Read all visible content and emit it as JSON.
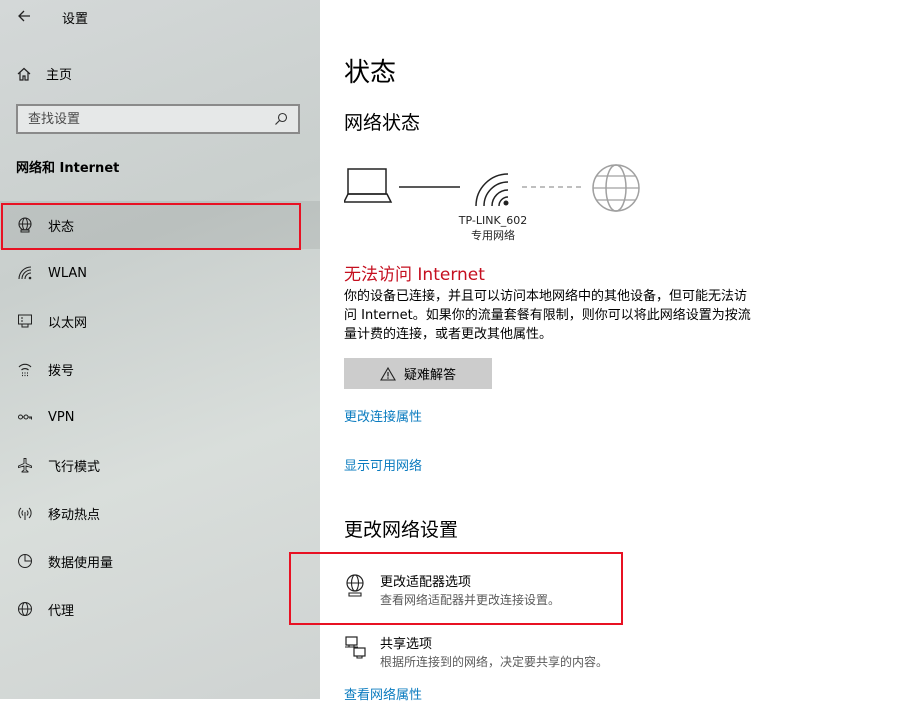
{
  "app": {
    "title": "设置"
  },
  "sidebar": {
    "home_label": "主页",
    "search_placeholder": "查找设置",
    "group_title": "网络和 Internet",
    "items": [
      {
        "label": "状态",
        "icon": "globe-status-icon",
        "selected": true
      },
      {
        "label": "WLAN",
        "icon": "wifi-icon"
      },
      {
        "label": "以太网",
        "icon": "ethernet-icon"
      },
      {
        "label": "拨号",
        "icon": "dialup-icon"
      },
      {
        "label": "VPN",
        "icon": "vpn-icon"
      },
      {
        "label": "飞行模式",
        "icon": "airplane-icon"
      },
      {
        "label": "移动热点",
        "icon": "hotspot-icon"
      },
      {
        "label": "数据使用量",
        "icon": "data-usage-icon"
      },
      {
        "label": "代理",
        "icon": "globe-icon"
      }
    ]
  },
  "main": {
    "page_title": "状态",
    "network_status_title": "网络状态",
    "network_name": "TP-LINK_602",
    "network_type": "专用网络",
    "warning": "无法访问 Internet",
    "description": "你的设备已连接，并且可以访问本地网络中的其他设备，但可能无法访问 Internet。如果你的流量套餐有限制，则你可以将此网络设置为按流量计费的连接，或者更改其他属性。",
    "troubleshoot_label": "疑难解答",
    "link_change_properties": "更改连接属性",
    "link_show_networks": "显示可用网络",
    "change_settings_title": "更改网络设置",
    "options": [
      {
        "title": "更改适配器选项",
        "desc": "查看网络适配器并更改连接设置。",
        "icon": "adapter-icon"
      },
      {
        "title": "共享选项",
        "desc": "根据所连接到的网络，决定要共享的内容。",
        "icon": "sharing-icon"
      }
    ],
    "link_view_properties": "查看网络属性"
  },
  "colors": {
    "warning": "#c50f1f",
    "link": "#0a7bbf",
    "highlight": "#e81123"
  }
}
